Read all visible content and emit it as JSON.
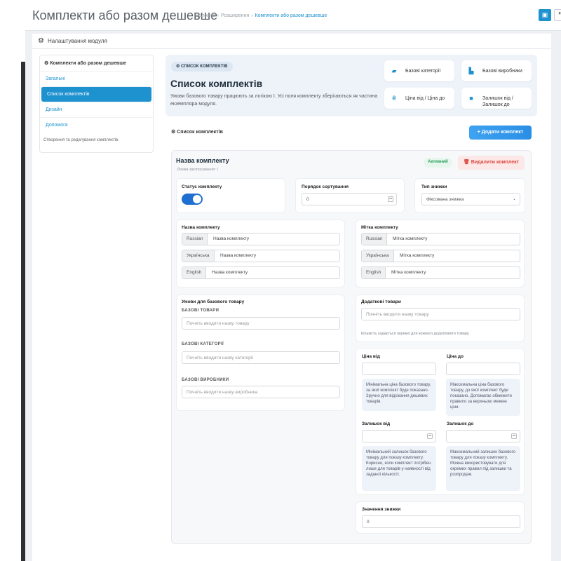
{
  "header": {
    "title": "Комплекти або разом дешевше",
    "breadcrumb": [
      "Головна",
      "Розширення",
      "Комплекти або разом дешевше"
    ],
    "save_icon": "save-icon",
    "back_icon": "back-icon"
  },
  "module_panel": {
    "title": "Налаштування модуля"
  },
  "sidebar": {
    "title": "Комплекти або разом дешевше",
    "items": [
      {
        "label": "Загальні"
      },
      {
        "label": "Список комплектів"
      },
      {
        "label": "Дизайн"
      },
      {
        "label": "Допомога"
      }
    ],
    "footer": "Створення та редагування комплектів."
  },
  "hero": {
    "pill": "СПИСОК КОМПЛЕКТІВ",
    "title": "Список комплектів",
    "description": "Умови базового товару працюють за логікою I. Усі поля комплекту зберігаються як частина екземпляра модуля.",
    "cards": [
      {
        "label": "Базові категорії"
      },
      {
        "label": "Базові виробники"
      },
      {
        "label": "Ціна від / Ціна до"
      },
      {
        "label": "Залишок від / Залишок до"
      }
    ]
  },
  "list": {
    "title": "Список комплектів",
    "add_button": "+ Додати комплект"
  },
  "kit": {
    "title": "Назва комплекту",
    "subtitle": "Логіка застосування: I",
    "badge": "Активний",
    "delete_button": "Видалити комплект",
    "status_label": "Статус комплекту",
    "status_on": true,
    "sort_label": "Порядок сортування",
    "sort_value": "0",
    "discount_type_label": "Тип знижки",
    "discount_type_value": "Фіксована знижка",
    "name_label": "Назва комплекту",
    "mark_label": "Мітка комплекту",
    "names": [
      {
        "lang": "Russian",
        "value": "Назва комплекту"
      },
      {
        "lang": "Українська",
        "value": "Назва комплекту"
      },
      {
        "lang": "English",
        "value": "Назва комплекту"
      }
    ],
    "marks": [
      {
        "lang": "Russian",
        "value": "Мітка комплекту"
      },
      {
        "lang": "Українська",
        "value": "Мітка комплекту"
      },
      {
        "lang": "English",
        "value": "Мітка комплекту"
      }
    ],
    "conditions": {
      "title": "Умови для базового товару",
      "products_label": "БАЗОВІ ТОВАРИ",
      "products_placeholder": "Почніть вводити назву товару",
      "categories_label": "БАЗОВІ КАТЕГОРІЇ",
      "categories_placeholder": "Почніть вводити назву категорії",
      "manufacturers_label": "БАЗОВІ ВИРОБНИКИ",
      "manufacturers_placeholder": "Почніть вводити назву виробника"
    },
    "extra": {
      "title": "Додаткові товари",
      "placeholder": "Почніть вводити назву товару",
      "note": "Кількість задається окремо для кожного додаткового товару."
    },
    "price_from_label": "Ціна від",
    "price_to_label": "Ціна до",
    "price_from_hint": "Мінімальна ціна базового товару, за якої комплект буде показано. Зручно для відсікання дешевих товарів.",
    "price_to_hint": "Максимальна ціна базового товару, до якої комплект буде показано. Допомагає обмежити правило за верхньою межею ціни.",
    "stock_from_label": "Залишок від",
    "stock_to_label": "Залишок до",
    "stock_from_hint": "Мінімальний залишок базового товару для показу комплекту. Корисно, коли комплект потрібен лише для товарів у наявності від заданої кількості.",
    "stock_to_hint": "Максимальний залишок базового товару для показу комплекту. Можна використовувати для окремих правил під залишки та розпродаж.",
    "discount_value_label": "Значення знижки",
    "discount_value": "0"
  }
}
